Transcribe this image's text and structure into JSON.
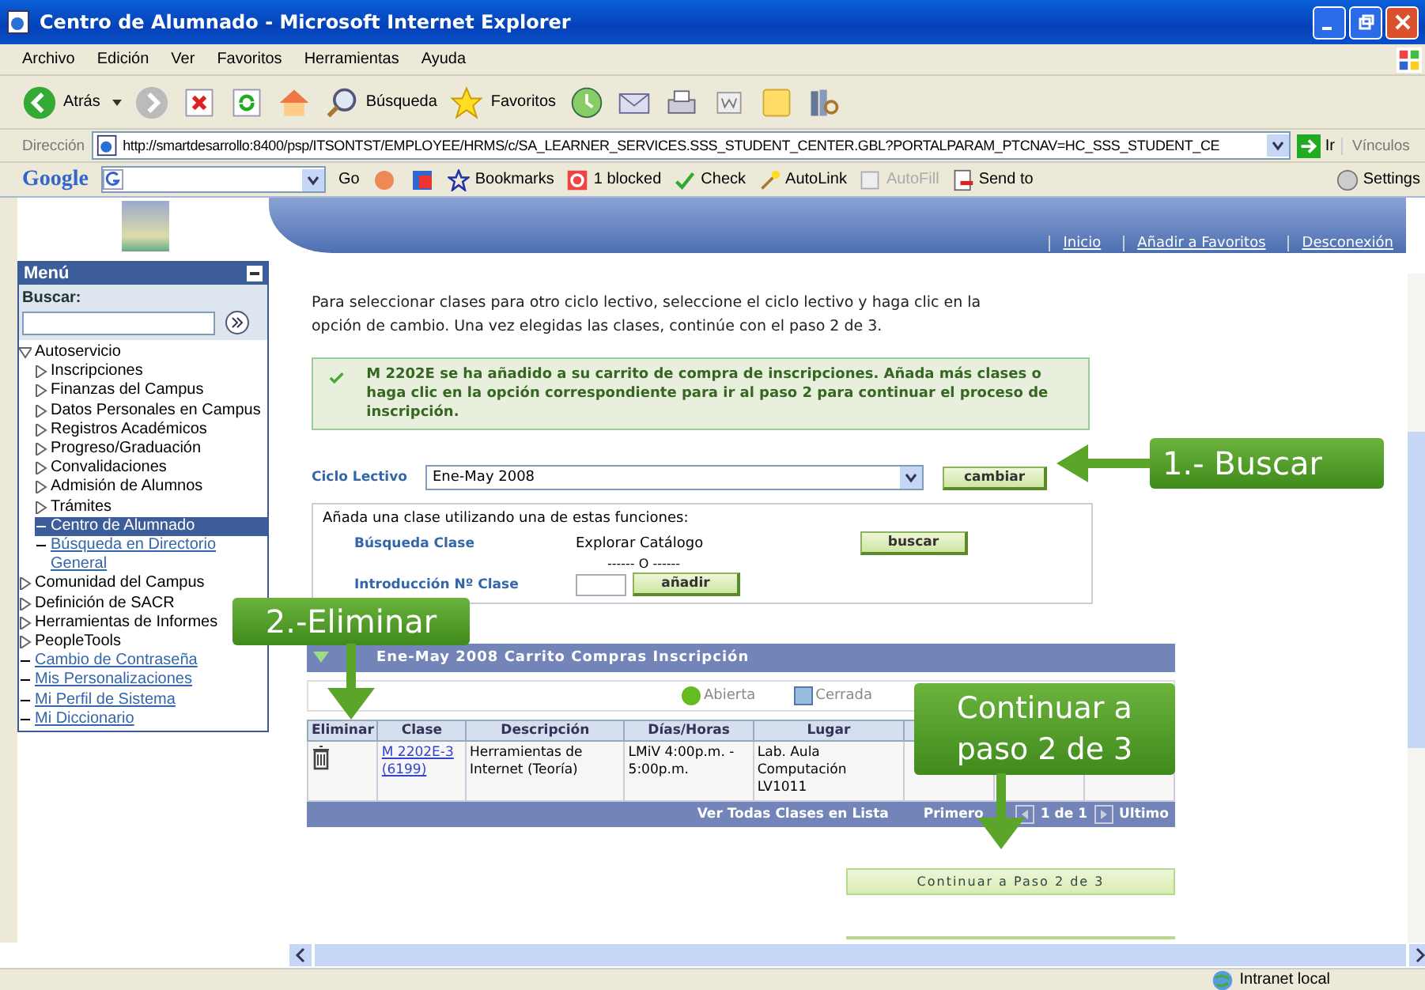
{
  "window": {
    "title": "Centro de Alumnado - Microsoft Internet Explorer"
  },
  "menu_bar": [
    "Archivo",
    "Edición",
    "Ver",
    "Favoritos",
    "Herramientas",
    "Ayuda"
  ],
  "toolbar": {
    "back": "Atrás",
    "search": "Búsqueda",
    "favorites": "Favoritos"
  },
  "address_bar": {
    "label": "Dirección",
    "url": "http://smartdesarrollo:8400/psp/ITSONTST/EMPLOYEE/HRMS/c/SA_LEARNER_SERVICES.SSS_STUDENT_CENTER.GBL?PORTALPARAM_PTCNAV=HC_SSS_STUDENT_CE",
    "go": "Ir",
    "links": "Vínculos"
  },
  "google_bar": {
    "logo": "Google",
    "go": "Go",
    "items": [
      {
        "label": "Bookmarks",
        "disabled": false
      },
      {
        "label": "1 blocked",
        "disabled": false
      },
      {
        "label": "Check",
        "disabled": false
      },
      {
        "label": "AutoLink",
        "disabled": false
      },
      {
        "label": "AutoFill",
        "disabled": true
      },
      {
        "label": "Send to",
        "disabled": false
      }
    ],
    "settings": "Settings"
  },
  "header_links": [
    "Inicio",
    "Añadir a Favoritos",
    "Desconexión"
  ],
  "sidebar": {
    "title": "Menú",
    "search_label": "Buscar:",
    "tree": [
      {
        "label": "Autoservicio",
        "kind": "folder",
        "expanded": true,
        "children": [
          {
            "label": "Inscripciones",
            "kind": "folder",
            "expanded": false
          },
          {
            "label": "Finanzas del Campus",
            "kind": "folder",
            "expanded": false
          },
          {
            "label": "Datos Personales en Campus",
            "kind": "folder",
            "expanded": false
          },
          {
            "label": "Registros Académicos",
            "kind": "folder",
            "expanded": false
          },
          {
            "label": "Progreso/Graduación",
            "kind": "folder",
            "expanded": false
          },
          {
            "label": "Convalidaciones",
            "kind": "folder",
            "expanded": false
          },
          {
            "label": "Admisión de Alumnos",
            "kind": "folder",
            "expanded": false
          },
          {
            "label": "Trámites",
            "kind": "folder",
            "expanded": false
          },
          {
            "label": "Centro de Alumnado",
            "kind": "page",
            "selected": true
          },
          {
            "label": "Búsqueda en Directorio General",
            "kind": "link",
            "selected": false
          }
        ]
      },
      {
        "label": "Comunidad del Campus",
        "kind": "folder",
        "expanded": false
      },
      {
        "label": "Definición de SACR",
        "kind": "folder",
        "expanded": false
      },
      {
        "label": "Herramientas de Informes",
        "kind": "folder",
        "expanded": false
      },
      {
        "label": "PeopleTools",
        "kind": "folder",
        "expanded": false
      },
      {
        "label": "Cambio de Contraseña",
        "kind": "link",
        "selected": false
      },
      {
        "label": "Mis Personalizaciones",
        "kind": "link",
        "selected": false
      },
      {
        "label": "Mi Perfil de Sistema",
        "kind": "link",
        "selected": false
      },
      {
        "label": "Mi Diccionario",
        "kind": "link",
        "selected": false
      }
    ]
  },
  "intro": "Para seleccionar clases para otro ciclo lectivo, seleccione el ciclo lectivo y haga clic en la opción de cambio. Una vez elegidas las clases, continúe con el paso 2 de 3.",
  "message": "M 2202E se ha añadido a su carrito de compra de inscripciones.  Añada más clases o haga clic en la opción correspondiente para ir al paso 2 para continuar el proceso de inscripción.",
  "term": {
    "label": "Ciclo Lectivo",
    "value": "Ene-May 2008",
    "button": "cambiar"
  },
  "add_class": {
    "title": "Añada una clase utilizando una de estas funciones:",
    "search_label": "Búsqueda Clase",
    "browse": "Explorar Catálogo",
    "or": "------ O ------",
    "search_button": "buscar",
    "number_label": "Introducción Nº Clase",
    "add_button": "añadir"
  },
  "cart": {
    "title": "Ene-May 2008 Carrito Compras Inscripción",
    "expanded": true,
    "legend": [
      {
        "label": "Abierta",
        "kind": "open"
      },
      {
        "label": "Cerrada",
        "kind": "closed"
      }
    ],
    "columns": [
      "Eliminar",
      "Clase",
      "Descripción",
      "Días/Horas",
      "Lugar"
    ],
    "rows": [
      {
        "class": "M 2202E-3 (6199)",
        "description": "Herramientas de Internet (Teoría)",
        "days": "LMiV 4:00p.m. - 5:00p.m.",
        "room": "Lab. Aula Computación LV1011"
      }
    ],
    "footer": {
      "view_all": "Ver Todas Clases en Lista",
      "first": "Primero",
      "page": "1 de 1",
      "last": "Ultimo"
    }
  },
  "continue_button": "Continuar a Paso 2 de 3",
  "callouts": [
    {
      "text": "1.- Buscar",
      "kind": "left"
    },
    {
      "text": "2.-Eliminar",
      "kind": "down"
    },
    {
      "text": "Continuar a paso 2 de 3",
      "kind": "down"
    }
  ],
  "status_bar": {
    "zone": "Intranet local"
  }
}
